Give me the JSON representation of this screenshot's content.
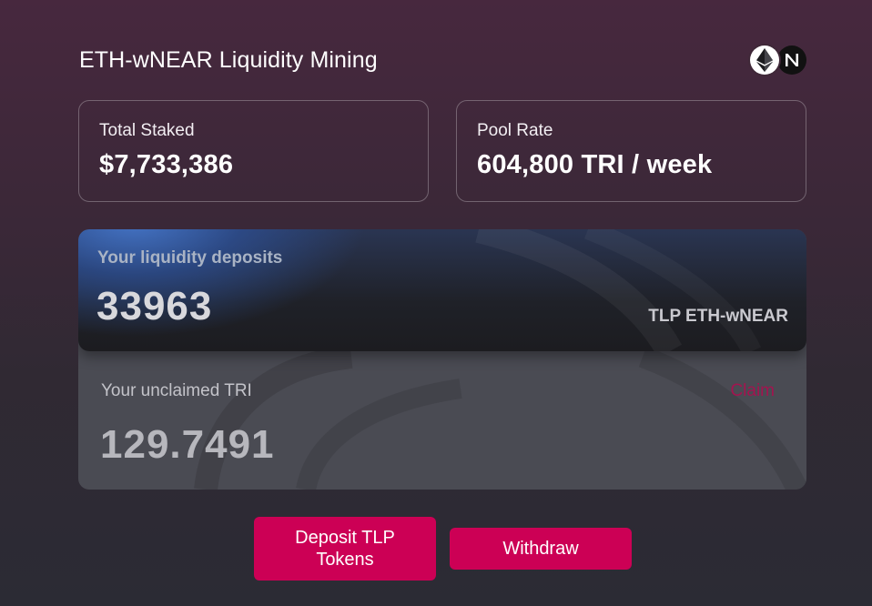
{
  "header": {
    "title": "ETH-wNEAR Liquidity Mining",
    "tokens": [
      "eth-icon",
      "near-icon"
    ]
  },
  "stats": {
    "total_staked": {
      "label": "Total Staked",
      "value": "$7,733,386"
    },
    "pool_rate": {
      "label": "Pool Rate",
      "value": "604,800 TRI / week"
    }
  },
  "deposits": {
    "liquidity_label": "Your liquidity deposits",
    "liquidity_value": "33963",
    "liquidity_unit": "TLP ETH-wNEAR",
    "unclaimed_label": "Your unclaimed TRI",
    "unclaimed_value": "129.7491",
    "claim_label": "Claim"
  },
  "actions": {
    "deposit_label": "Deposit TLP Tokens",
    "withdraw_label": "Withdraw"
  },
  "colors": {
    "accent": "#cc0055",
    "claim": "#a3144f",
    "liquidity_gradient": "#4678cd"
  }
}
